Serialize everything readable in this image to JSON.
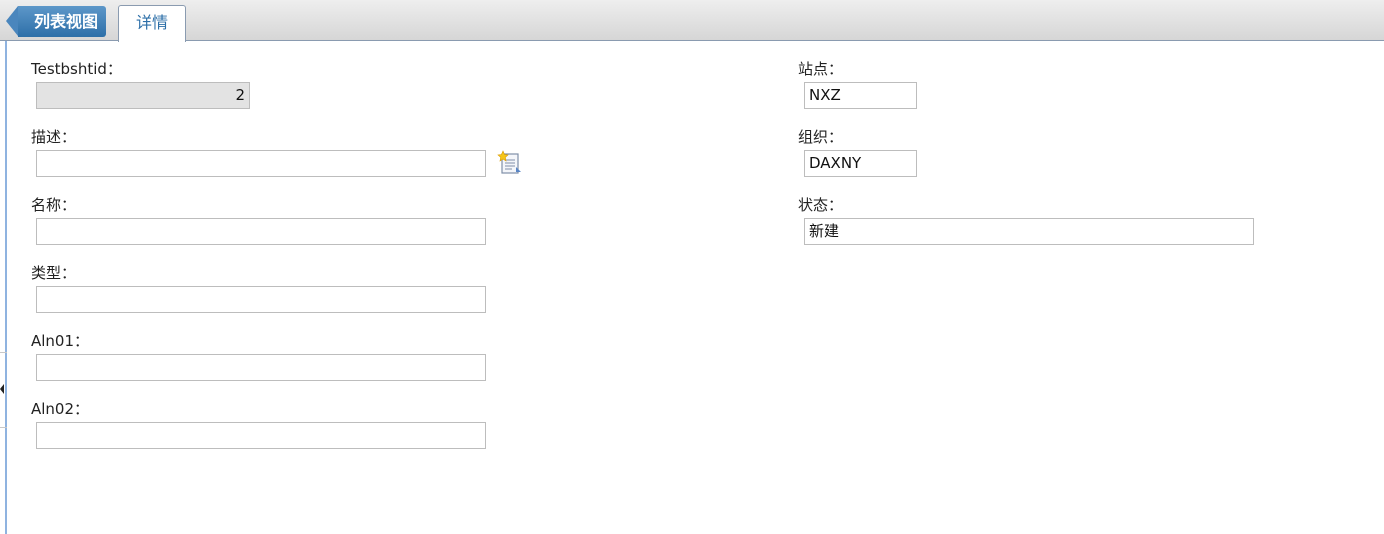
{
  "tabs": {
    "back_label": "列表视图",
    "active_label": "详情"
  },
  "left": {
    "testbshtid": {
      "label": "Testbshtid：",
      "value": "2"
    },
    "description": {
      "label": "描述：",
      "value": ""
    },
    "name": {
      "label": "名称：",
      "value": ""
    },
    "type": {
      "label": "类型：",
      "value": ""
    },
    "aln01": {
      "label": "Aln01：",
      "value": ""
    },
    "aln02": {
      "label": "Aln02：",
      "value": ""
    }
  },
  "right": {
    "site": {
      "label": "站点：",
      "value": "NXZ"
    },
    "org": {
      "label": "组织：",
      "value": "DAXNY"
    },
    "status": {
      "label": "状态：",
      "value": "新建"
    }
  },
  "icons": {
    "description_lookup": "long-description-icon"
  }
}
